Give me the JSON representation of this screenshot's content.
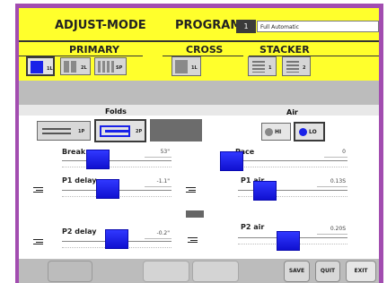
{
  "header": {
    "mode_title": "ADJUST-MODE",
    "program_label": "PROGRAM",
    "program_number": "1",
    "program_name": "Full Automatic",
    "primary_label": "PRIMARY",
    "cross_label": "CROSS",
    "stacker_label": "STACKER",
    "primary_buttons": [
      {
        "label": "1L",
        "selected": true
      },
      {
        "label": "2L",
        "selected": false
      },
      {
        "label": "SP",
        "selected": false
      }
    ],
    "cross_buttons": [
      {
        "label": "1L",
        "selected": false
      }
    ],
    "stacker_buttons": [
      {
        "label": "1",
        "selected": false
      },
      {
        "label": "2",
        "selected": false
      }
    ]
  },
  "folds": {
    "title": "Folds",
    "options": [
      {
        "label": "1P",
        "selected": false
      },
      {
        "label": "2P",
        "selected": true
      }
    ]
  },
  "air": {
    "title": "Air",
    "options": [
      {
        "label": "HI",
        "selected": false
      },
      {
        "label": "LO",
        "selected": true
      }
    ]
  },
  "sliders": {
    "break": {
      "label": "Break",
      "value": "53\"",
      "level": 0.28
    },
    "pace": {
      "label": "Pace",
      "value": "0",
      "level": 0.0
    },
    "p1_delay": {
      "label": "P1 delay",
      "value": "-1.1\"",
      "level": 0.4
    },
    "p1_air": {
      "label": "P1 air",
      "value": "0.13S",
      "level": 0.18
    },
    "p2_delay": {
      "label": "P2 delay",
      "value": "-0.2\"",
      "level": 0.5
    },
    "p2_air": {
      "label": "P2 air",
      "value": "0.20S",
      "level": 0.45
    }
  },
  "footer": {
    "save": "SAVE",
    "quit": "QUIT",
    "exit": "EXIT"
  },
  "colors": {
    "header_bg": "#ffff2c",
    "frame": "#a24db0",
    "slider_thumb": "#1c1ef0",
    "selected_square": "#1a22e8"
  }
}
